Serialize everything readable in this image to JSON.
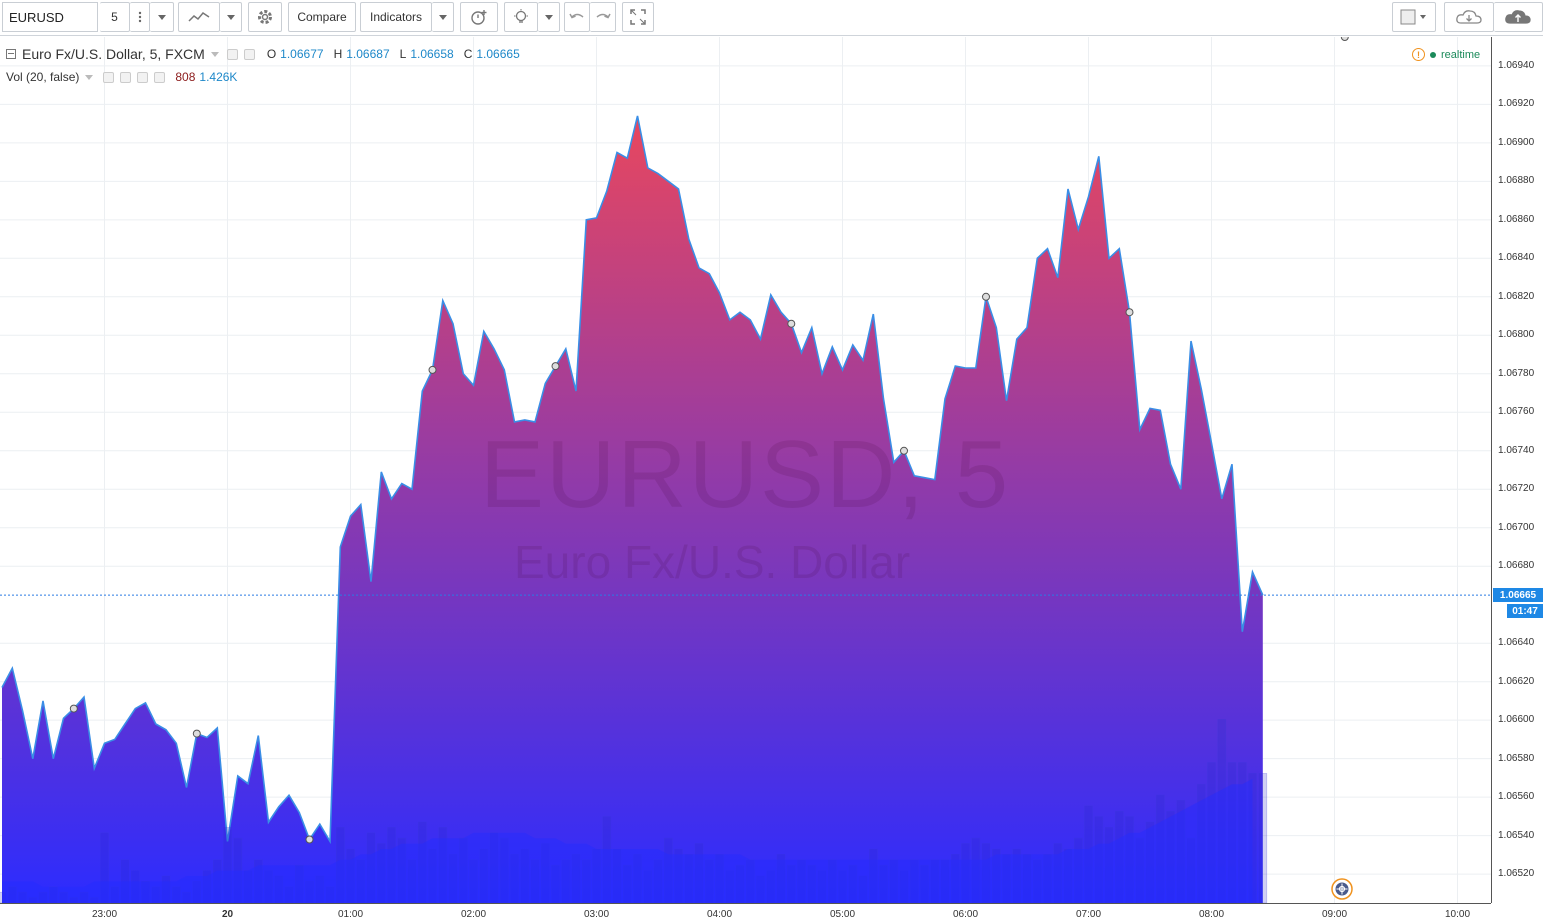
{
  "toolbar": {
    "symbol": "EURUSD",
    "interval": "5",
    "compare_label": "Compare",
    "indicators_label": "Indicators"
  },
  "legend": {
    "title": "Euro Fx/U.S. Dollar, 5, FXCM",
    "open_label": "O",
    "open": "1.06677",
    "high_label": "H",
    "high": "1.06687",
    "low_label": "L",
    "low": "1.06658",
    "close_label": "C",
    "close": "1.06665",
    "volume_title": "Vol (20, false)",
    "volume_value": "808",
    "volume_ma": "1.426K"
  },
  "status": {
    "realtime_label": "realtime"
  },
  "watermark": {
    "symbol": "EURUSD, 5",
    "description": "Euro Fx/U.S. Dollar"
  },
  "last_price": {
    "price": "1.06665",
    "countdown": "01:47"
  },
  "colors": {
    "area_top": "#e8475e",
    "area_bottom": "#2c2cff",
    "line": "#3a8ee6",
    "price_label": "#1e88e5",
    "ohlc_value": "#1e88c9",
    "volume_value": "#8b1a1a",
    "realtime": "#1b8a5a"
  },
  "icons": [
    "chart-style-icon",
    "gear-icon",
    "alert-add-icon",
    "idea-icon",
    "undo-icon",
    "redo-icon",
    "fullscreen-icon",
    "layout-icon",
    "cloud-download-icon",
    "cloud-upload-icon",
    "goto-realtime-icon"
  ],
  "chart_data": {
    "type": "area",
    "price_ticks": [
      "1.06940",
      "1.06920",
      "1.06900",
      "1.06880",
      "1.06860",
      "1.06840",
      "1.06820",
      "1.06800",
      "1.06780",
      "1.06760",
      "1.06740",
      "1.06720",
      "1.06700",
      "1.06680",
      "1.06640",
      "1.06620",
      "1.06600",
      "1.06580",
      "1.06560",
      "1.06540",
      "1.06520"
    ],
    "ylim": [
      1.06505,
      1.06955
    ],
    "time_ticks": [
      "23:00",
      "20",
      "01:00",
      "02:00",
      "03:00",
      "04:00",
      "05:00",
      "06:00",
      "07:00",
      "08:00",
      "09:00",
      "10:00"
    ],
    "x_index_range": [
      0,
      144
    ],
    "series": [
      {
        "kind": "price",
        "values": [
          1.06617,
          1.06627,
          1.06605,
          1.0658,
          1.0661,
          1.0658,
          1.06601,
          1.06606,
          1.06612,
          1.06575,
          1.06588,
          1.0659,
          1.06598,
          1.06606,
          1.06609,
          1.06598,
          1.06595,
          1.06588,
          1.06565,
          1.06593,
          1.06591,
          1.06596,
          1.06537,
          1.06571,
          1.06567,
          1.06592,
          1.06547,
          1.06555,
          1.06561,
          1.06552,
          1.06538,
          1.06546,
          1.06537,
          1.0669,
          1.06706,
          1.06712,
          1.06672,
          1.06729,
          1.06715,
          1.06723,
          1.0672,
          1.06771,
          1.06782,
          1.06818,
          1.06806,
          1.0678,
          1.06774,
          1.06802,
          1.06793,
          1.06782,
          1.06755,
          1.06756,
          1.06755,
          1.06775,
          1.06784,
          1.06793,
          1.06771,
          1.0686,
          1.06861,
          1.06875,
          1.06895,
          1.06892,
          1.06914,
          1.06887,
          1.06884,
          1.0688,
          1.06876,
          1.0685,
          1.06835,
          1.06832,
          1.06822,
          1.06808,
          1.06812,
          1.06808,
          1.06798,
          1.06821,
          1.06812,
          1.06806,
          1.06791,
          1.06804,
          1.0678,
          1.06794,
          1.06782,
          1.06795,
          1.06787,
          1.06811,
          1.06767,
          1.06734,
          1.0674,
          1.06727,
          1.06726,
          1.06725,
          1.06767,
          1.06784,
          1.06783,
          1.06783,
          1.0682,
          1.06804,
          1.06766,
          1.06798,
          1.06804,
          1.0684,
          1.06845,
          1.0683,
          1.06876,
          1.06855,
          1.06872,
          1.06893,
          1.0684,
          1.06845,
          1.06812,
          1.06751,
          1.06762,
          1.06761,
          1.06733,
          1.0672,
          1.06797,
          1.06772,
          1.06744,
          1.06715,
          1.06733,
          1.06646,
          1.06677,
          1.06665
        ]
      },
      {
        "kind": "volume",
        "values": [
          2,
          3,
          2,
          1,
          2,
          3,
          2,
          1,
          2,
          1,
          13,
          3,
          8,
          6,
          4,
          3,
          5,
          3,
          2,
          4,
          6,
          8,
          14,
          12,
          6,
          8,
          6,
          5,
          3,
          7,
          4,
          5,
          3,
          14,
          10,
          8,
          13,
          11,
          14,
          12,
          8,
          15,
          10,
          14,
          9,
          12,
          8,
          10,
          13,
          12,
          9,
          10,
          8,
          11,
          7,
          8,
          9,
          8,
          10,
          16,
          10,
          7,
          9,
          6,
          8,
          12,
          10,
          9,
          11,
          8,
          9,
          6,
          7,
          8,
          5,
          6,
          9,
          7,
          8,
          7,
          6,
          8,
          6,
          7,
          5,
          10,
          7,
          8,
          6,
          8,
          7,
          8,
          8,
          9,
          11,
          12,
          11,
          10,
          9,
          10,
          9,
          8,
          9,
          11,
          10,
          12,
          18,
          16,
          14,
          17,
          16,
          12,
          15,
          20,
          17,
          19,
          12,
          22,
          26,
          34,
          26,
          26,
          24,
          24
        ],
        "ma_values": [
          4,
          4,
          4,
          4,
          3,
          3,
          3,
          3,
          3,
          4,
          4,
          4,
          4,
          4,
          4,
          4,
          4,
          4,
          5,
          5,
          5,
          6,
          6,
          6,
          6,
          7,
          7,
          7,
          7,
          7,
          7,
          7,
          7,
          8,
          8,
          9,
          9,
          10,
          10,
          11,
          11,
          11,
          12,
          12,
          12,
          12,
          13,
          13,
          13,
          13,
          13,
          13,
          12,
          12,
          12,
          11,
          11,
          11,
          10,
          10,
          10,
          10,
          10,
          10,
          10,
          9,
          9,
          9,
          9,
          9,
          9,
          9,
          9,
          8,
          8,
          8,
          8,
          8,
          8,
          8,
          8,
          8,
          8,
          8,
          8,
          8,
          8,
          8,
          8,
          8,
          8,
          8,
          8,
          8,
          8,
          8,
          8,
          9,
          9,
          9,
          9,
          9,
          9,
          9,
          10,
          10,
          10,
          11,
          11,
          12,
          13,
          13,
          14,
          15,
          16,
          17,
          18,
          19,
          20,
          21,
          22,
          22,
          23
        ]
      }
    ],
    "markers": [
      7,
      19,
      30,
      42,
      54,
      77,
      88,
      96,
      110,
      131
    ]
  }
}
